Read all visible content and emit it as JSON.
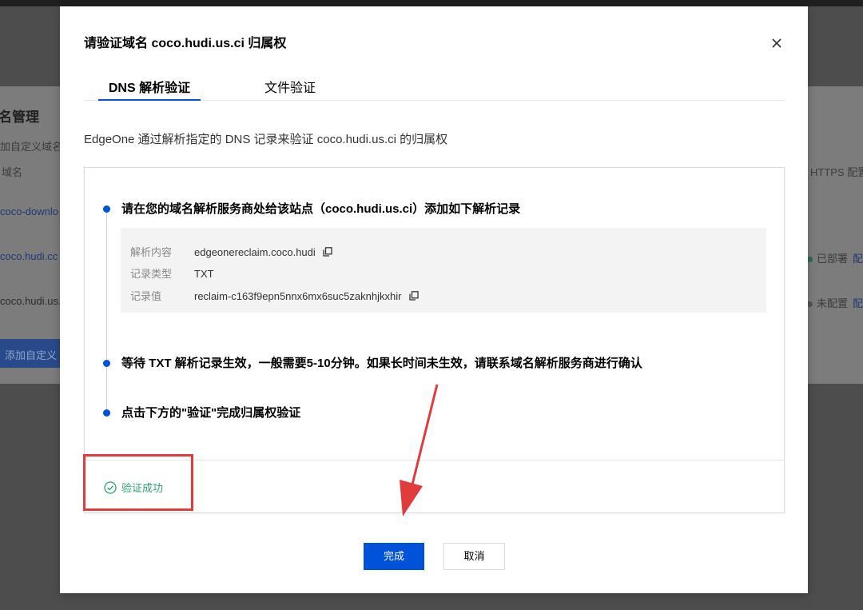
{
  "background": {
    "title": "名管理",
    "subtitle": "加自定义域名",
    "column_header": "域名",
    "rows": [
      "coco-downlo",
      "coco.hudi.cc",
      "coco.hudi.us."
    ],
    "add_button": "添加自定义",
    "right_column_header": "HTTPS 配置",
    "right_status": [
      {
        "label": "已部署",
        "link": "配",
        "dot_color": "#2ba471"
      },
      {
        "label": "未配置",
        "link": "配",
        "dot_color": "#888888"
      }
    ]
  },
  "modal": {
    "title": "请验证域名 coco.hudi.us.ci 归属权",
    "close_icon": "close-icon",
    "tabs": [
      {
        "label": "DNS 解析验证",
        "active": true
      },
      {
        "label": "文件验证",
        "active": false
      }
    ],
    "description": "EdgeOne 通过解析指定的 DNS 记录来验证 coco.hudi.us.ci 的归属权",
    "steps": [
      "请在您的域名解析服务商处给该站点（coco.hudi.us.ci）添加如下解析记录",
      "等待 TXT 解析记录生效，一般需要5-10分钟。如果长时间未生效，请联系域名解析服务商进行确认",
      "点击下方的\"验证\"完成归属权验证"
    ],
    "record": {
      "host_label": "解析内容",
      "host_value": "edgeonereclaim.coco.hudi",
      "type_label": "记录类型",
      "type_value": "TXT",
      "value_label": "记录值",
      "value_value": "reclaim-c163f9epn5nnx6mx6suc5zaknhjkxhir"
    },
    "status": "验证成功",
    "buttons": {
      "done": "完成",
      "cancel": "取消"
    },
    "colors": {
      "primary": "#0052d9",
      "success": "#2ba471",
      "highlight": "#e23b3b"
    }
  }
}
